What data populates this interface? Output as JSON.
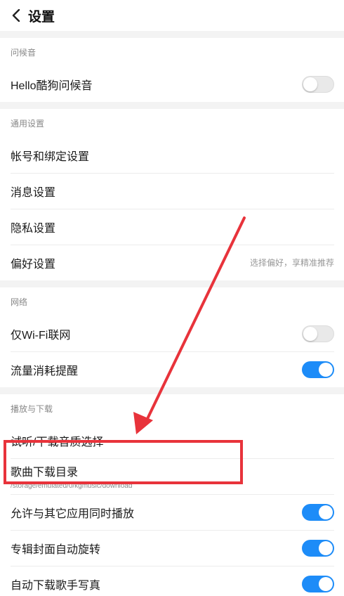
{
  "header": {
    "title": "设置"
  },
  "sections": {
    "greeting": {
      "title": "问候音",
      "hello_label": "Hello酷狗问候音",
      "hello_on": false
    },
    "general": {
      "title": "通用设置",
      "account_label": "帐号和绑定设置",
      "message_label": "消息设置",
      "privacy_label": "隐私设置",
      "preference_label": "偏好设置",
      "preference_hint": "选择偏好，享精准推荐"
    },
    "network": {
      "title": "网络",
      "wifi_only_label": "仅Wi-Fi联网",
      "wifi_only_on": false,
      "data_usage_label": "流量消耗提醒",
      "data_usage_on": true
    },
    "play_download": {
      "title": "播放与下载",
      "quality_label": "试听/下载音质选择",
      "download_dir_label": "歌曲下载目录",
      "download_dir_path": "/storage/emulated/0/kgmusic/download",
      "concurrent_label": "允许与其它应用同时播放",
      "concurrent_on": true,
      "album_rotate_label": "专辑封面自动旋转",
      "album_rotate_on": true,
      "auto_photo_label": "自动下载歌手写真",
      "auto_photo_on": true
    }
  },
  "colors": {
    "accent": "#1d8cf8",
    "annotation": "#e8333b",
    "divider": "#f3f3f3"
  }
}
